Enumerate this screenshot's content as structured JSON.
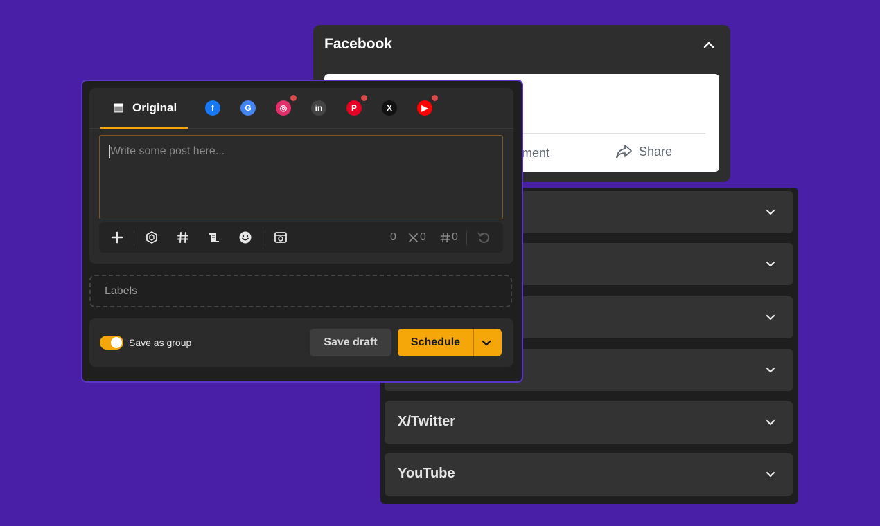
{
  "facebook_preview": {
    "title": "Facebook",
    "comment_label": "mment",
    "share_label": "Share"
  },
  "accordion": {
    "items": [
      {
        "label": ""
      },
      {
        "label": ""
      },
      {
        "label": ""
      },
      {
        "label": ""
      },
      {
        "label": "X/Twitter"
      },
      {
        "label": "YouTube"
      }
    ]
  },
  "composer": {
    "tabs": {
      "original_label": "Original",
      "networks": [
        {
          "name": "facebook",
          "icon": "facebook-icon",
          "color": "#1877f2",
          "glyph": "f",
          "has_alert": false
        },
        {
          "name": "google",
          "icon": "google-icon",
          "color": "#4285f4",
          "glyph": "G",
          "has_alert": false
        },
        {
          "name": "instagram",
          "icon": "instagram-icon",
          "color": "#e1306c",
          "glyph": "◎",
          "has_alert": true
        },
        {
          "name": "linkedin",
          "icon": "linkedin-icon",
          "color": "#444444",
          "glyph": "in",
          "has_alert": false
        },
        {
          "name": "pinterest",
          "icon": "pinterest-icon",
          "color": "#e60023",
          "glyph": "P",
          "has_alert": true
        },
        {
          "name": "x",
          "icon": "x-icon",
          "color": "#111111",
          "glyph": "X",
          "has_alert": false
        },
        {
          "name": "youtube",
          "icon": "youtube-icon",
          "color": "#ff0000",
          "glyph": "▶",
          "has_alert": true
        }
      ]
    },
    "editor": {
      "placeholder": "Write some post here...",
      "value": ""
    },
    "toolbar": {
      "char_count": "0",
      "x_count": "0",
      "hashtag_count": "0"
    },
    "labels_placeholder": "Labels",
    "footer": {
      "save_as_group_label": "Save as group",
      "save_as_group_on": true,
      "save_draft_label": "Save draft",
      "schedule_label": "Schedule"
    }
  },
  "colors": {
    "background": "#4a1fa8",
    "accent": "#f5a70a",
    "alert_dot": "#d94a4a"
  }
}
